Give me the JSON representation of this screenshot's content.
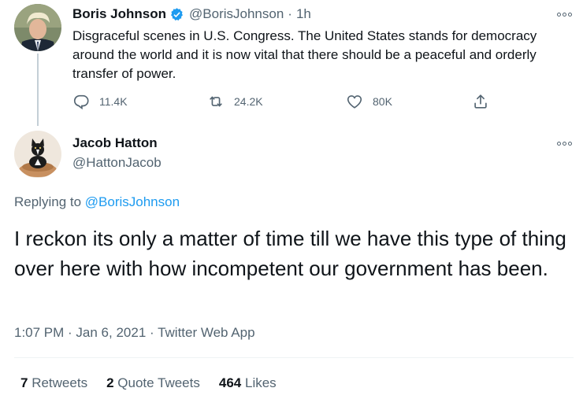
{
  "parent_tweet": {
    "author_name": "Boris Johnson",
    "author_handle": "@BorisJohnson",
    "separator": "·",
    "time": "1h",
    "text": "Disgraceful scenes in U.S. Congress. The United States stands for democracy around the world and it is now vital that there should be a peaceful and orderly transfer of power.",
    "replies": "11.4K",
    "retweets": "24.2K",
    "likes": "80K"
  },
  "reply_tweet": {
    "author_name": "Jacob Hatton",
    "author_handle": "@HattonJacob",
    "replying_prefix": "Replying to ",
    "replying_to": "@BorisJohnson",
    "text": "I reckon its only a matter of time till we have this type of thing over here with how incompetent our government has been.",
    "timestamp": "1:07 PM · Jan 6, 2021 · Twitter Web App",
    "stats": {
      "retweets_count": "7",
      "retweets_label": "Retweets",
      "quotes_count": "2",
      "quotes_label": "Quote Tweets",
      "likes_count": "464",
      "likes_label": "Likes"
    }
  },
  "icons": {
    "reply": "reply-icon",
    "retweet": "retweet-icon",
    "like": "heart-icon",
    "share": "share-icon",
    "verified": "verified-badge-icon",
    "more": "more-options-icon"
  },
  "colors": {
    "accent": "#1d9bf0",
    "text_primary": "#0f1419",
    "text_secondary": "#536471"
  }
}
